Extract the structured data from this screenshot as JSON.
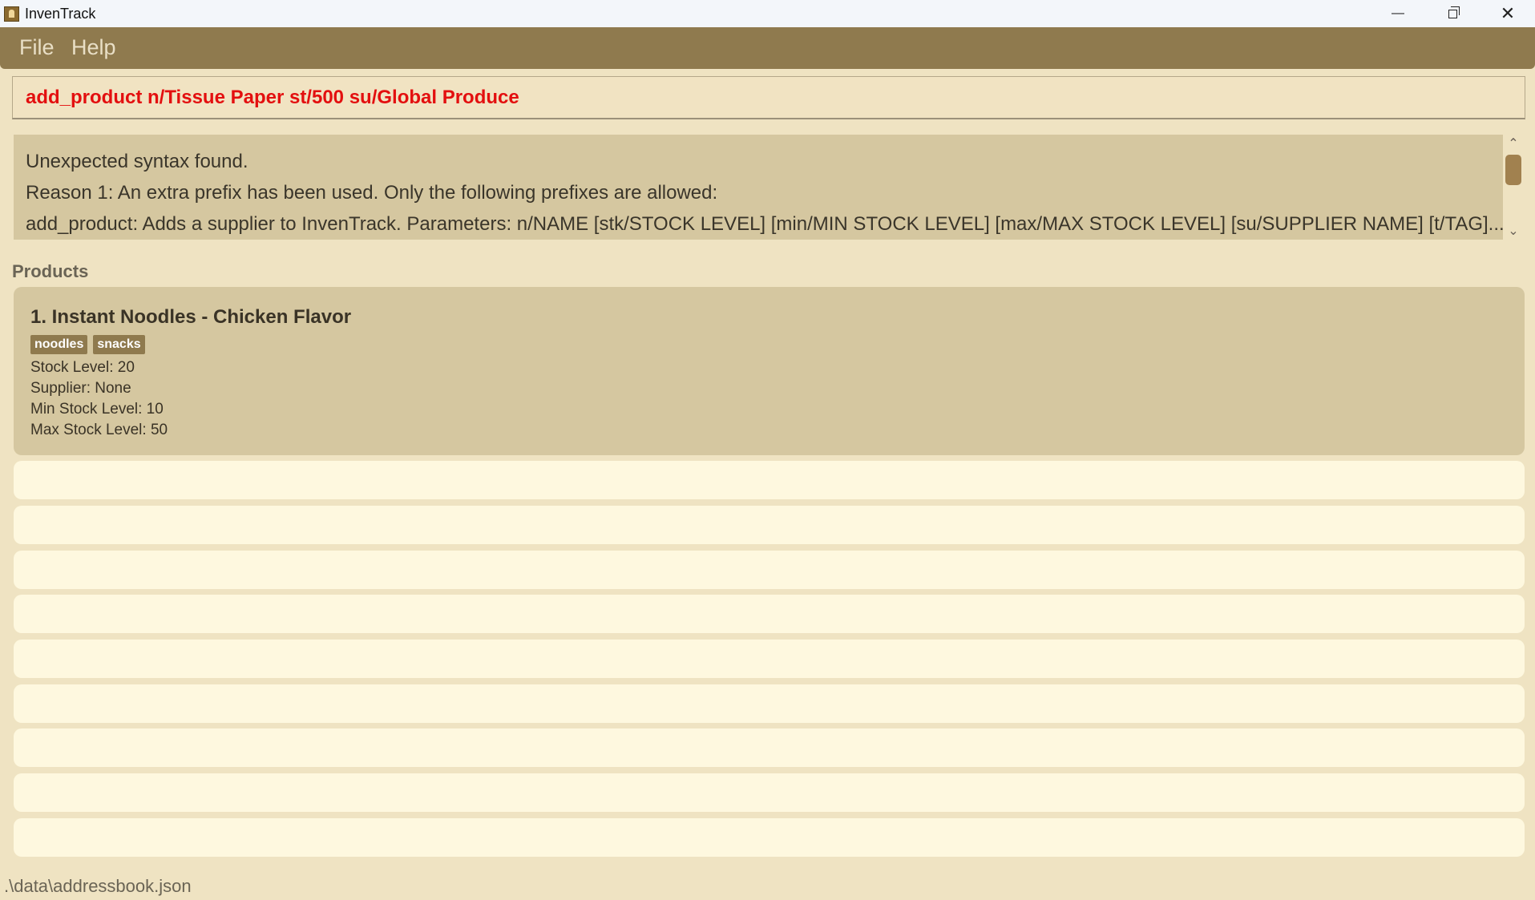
{
  "window": {
    "title": "InvenTrack",
    "controls": {
      "minimize": "—",
      "close": "✕"
    }
  },
  "menu": {
    "file": "File",
    "help": "Help"
  },
  "command_box": {
    "value": "add_product n/Tissue Paper st/500 su/Global Produce",
    "color": "#e30f0f"
  },
  "result": {
    "lines": [
      "Unexpected syntax found.",
      "Reason 1: An extra prefix has been used. Only the following prefixes are allowed:",
      "add_product: Adds a supplier to InvenTrack. Parameters: n/NAME [stk/STOCK LEVEL] [min/MIN STOCK LEVEL] [max/MAX STOCK LEVEL] [su/SUPPLIER NAME] [t/TAG]..."
    ],
    "scroll_up": "⌃",
    "scroll_down": "⌄"
  },
  "products": {
    "title": "Products",
    "items": [
      {
        "heading": "1. Instant Noodles - Chicken Flavor",
        "tags": [
          "noodles",
          "snacks"
        ],
        "stock": "Stock Level: 20",
        "supplier": "Supplier: None",
        "min": "Min Stock Level: 10",
        "max": "Max Stock Level: 50"
      }
    ]
  },
  "status_bar": {
    "path": ".\\data\\addressbook.json"
  },
  "colors": {
    "menubar": "#8f7a4e",
    "background": "#efe3c2",
    "card_selected": "#d5c7a0",
    "card_empty": "#fef8df"
  }
}
